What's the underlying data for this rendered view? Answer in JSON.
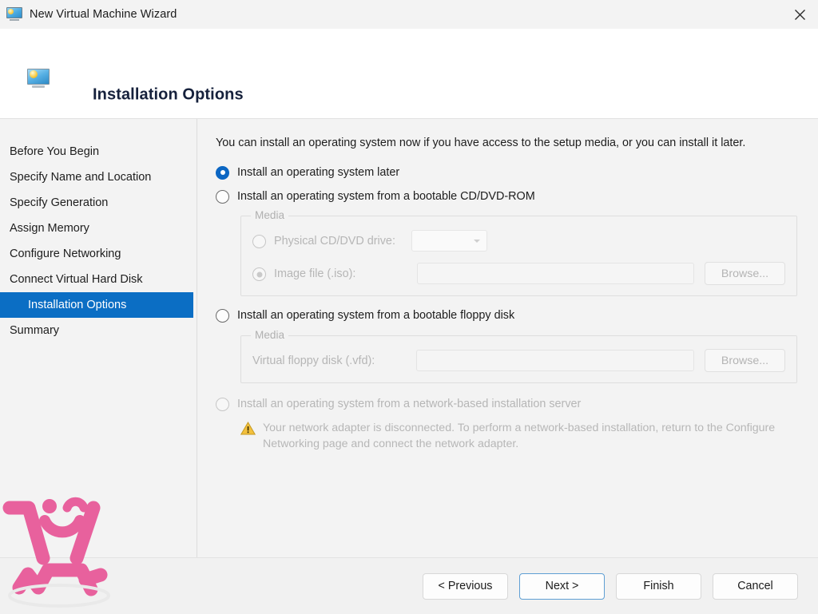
{
  "window": {
    "title": "New Virtual Machine Wizard",
    "icon": "monitor-icon",
    "close_label": "✕"
  },
  "banner": {
    "title": "Installation Options",
    "icon": "monitor-icon"
  },
  "sidebar": {
    "items": [
      {
        "label": "Before You Begin",
        "selected": false,
        "indent": false
      },
      {
        "label": "Specify Name and Location",
        "selected": false,
        "indent": false
      },
      {
        "label": "Specify Generation",
        "selected": false,
        "indent": false
      },
      {
        "label": "Assign Memory",
        "selected": false,
        "indent": false
      },
      {
        "label": "Configure Networking",
        "selected": false,
        "indent": false
      },
      {
        "label": "Connect Virtual Hard Disk",
        "selected": false,
        "indent": false
      },
      {
        "label": "Installation Options",
        "selected": true,
        "indent": true
      },
      {
        "label": "Summary",
        "selected": false,
        "indent": false
      }
    ],
    "selected_color": "#0b6ec4"
  },
  "main": {
    "intro": "You can install an operating system now if you have access to the setup media, or you can install it later.",
    "option_later": "Install an operating system later",
    "option_cd": "Install an operating system from a bootable CD/DVD-ROM",
    "cd_media": {
      "legend": "Media",
      "physical_drive_label": "Physical CD/DVD drive:",
      "drive_value": "",
      "image_file_label": "Image file (.iso):",
      "image_file_value": "",
      "browse_label": "Browse..."
    },
    "option_floppy": "Install an operating system from a bootable floppy disk",
    "floppy_media": {
      "legend": "Media",
      "vfd_label": "Virtual floppy disk (.vfd):",
      "vfd_value": "",
      "browse_label": "Browse..."
    },
    "option_network": "Install an operating system from a network-based installation server",
    "network_warning": "Your network adapter is disconnected. To perform a network-based installation, return to the Configure Networking page and connect the network adapter.",
    "warning_icon": "warning-triangle-icon"
  },
  "footer": {
    "previous": "< Previous",
    "next": "Next >",
    "finish": "Finish",
    "cancel": "Cancel"
  },
  "watermark": {
    "name": "pink-smiley-stick-figure-watermark",
    "color": "#e8619d"
  }
}
